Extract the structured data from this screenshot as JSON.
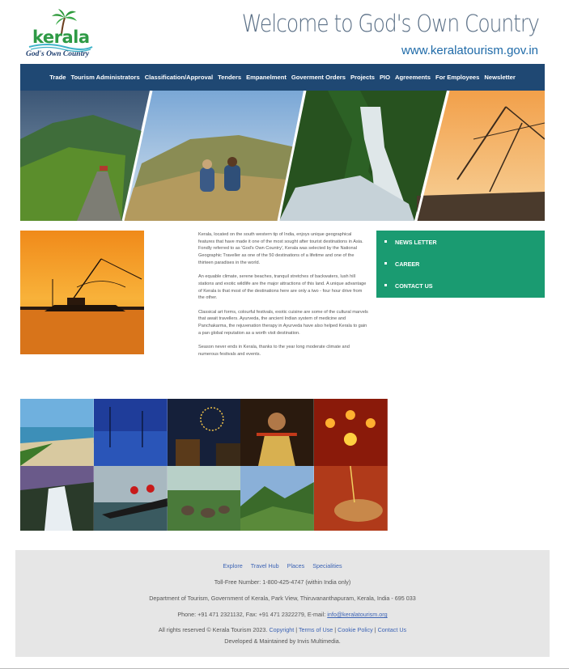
{
  "header": {
    "logo_word": "kerala",
    "logo_tagline": "God's Own Country",
    "title": "Welcome to God's Own Country",
    "url": "www.keralatourism.gov.in"
  },
  "nav": {
    "items": [
      "Trade",
      "Tourism Administrators",
      "Classification/Approval",
      "Tenders",
      "Empanelment",
      "Goverment Orders",
      "Projects",
      "PIO",
      "Agreements",
      "For Employees",
      "Newsletter"
    ]
  },
  "intro": {
    "paragraphs": [
      "Kerala, located on the south western tip of India, enjoys unique geographical features that have made it one of the most sought after tourist destinations in Asia. Fondly referred to as 'God's Own Country', Kerala was selected by the National Geographic Traveller as one of the 50 destinations of a lifetime and one of the thirteen paradises in the world.",
      "An equable climate, serene beaches, tranquil stretches of backwaters, lush hill stations and exotic wildlife are the major attractions of this land. A unique advantage of Kerala is that most of the destinations here are only a two - four hour drive from the other.",
      "Classical art forms, colourful festivals, exotic cuisine are some of the cultural marvels that await travellers. Ayurveda, the ancient Indian system of medicine and Panchakarma, the rejuvenation therapy in Ayurveda have also helped Kerala to gain a pan global reputation as a worth visit destination.",
      "Season never ends in Kerala, thanks to the year long moderate climate and numerous festivals and events."
    ]
  },
  "quicklinks": {
    "items": [
      "NEWS LETTER",
      "CAREER",
      "CONTACT US"
    ]
  },
  "footer": {
    "links": [
      "Explore",
      "Travel Hub",
      "Places",
      "Specialities"
    ],
    "tollfree": "Toll-Free Number: 1-800-425-4747 (within India only)",
    "address": "Department of Tourism, Government of Kerala, Park View, Thiruvananthapuram, Kerala, India - 695 033",
    "phone_prefix": "Phone: +91 471 2321132, Fax: +91 471 2322279, E-mail:",
    "email": "info@keralatourism.org",
    "rights": "All rights reserved © Kerala Tourism 2023.",
    "copyright_link": "Copyright",
    "terms_link": "Terms of Use",
    "cookie_link": "Cookie Policy",
    "contact_link": "Contact Us",
    "developed": "Developed & Maintained by Invis Multimedia.",
    "sep": "|"
  },
  "colors": {
    "nav_bg": "#1f4873",
    "quicklinks_bg": "#1a9b71",
    "footer_bg": "#e6e6e6",
    "link": "#3d64b5",
    "title": "#5a6f86"
  }
}
